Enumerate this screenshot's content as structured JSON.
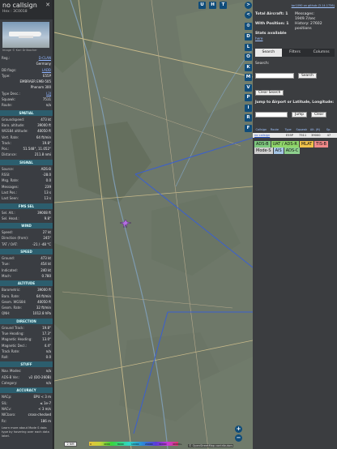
{
  "info": {
    "callsign": "no callsign",
    "hex": "Hex : 3C0018",
    "photo_credit": "Image © Karl Drilbacher",
    "details": [
      {
        "k": "Reg.:",
        "v": "D-CLAN",
        "link": true
      },
      {
        "k": "",
        "v": "Germany",
        "link": false
      },
      {
        "k": "DB flags:",
        "v": "LADD",
        "link": true
      },
      {
        "k": "Type:",
        "v": "E55P",
        "link": false
      },
      {
        "k": "",
        "v": "EMBRAER EMB-505",
        "link": false
      },
      {
        "k": "",
        "v": "Phenom 300",
        "link": false
      },
      {
        "k": "Type Desc.:",
        "v": "L2J",
        "link": true
      },
      {
        "k": "Squawk:",
        "v": "7511",
        "link": false
      },
      {
        "k": "Route:",
        "v": "n/a",
        "link": false
      }
    ],
    "sections": [
      {
        "title": "SPATIAL",
        "rows": [
          {
            "k": "Groundspeed:",
            "v": "473 kt"
          },
          {
            "k": "Baro. altitude:",
            "v": "39000 ft"
          },
          {
            "k": "WGS84 altitude:",
            "v": "40050 ft"
          },
          {
            "k": "Vert. Rate:",
            "v": "64 ft/min"
          },
          {
            "k": "Track:",
            "v": "19.8°"
          },
          {
            "k": "Pos.:",
            "v": "51.548°, 11.052°"
          },
          {
            "k": "Distance:",
            "v": "211.8 nmi"
          }
        ]
      },
      {
        "title": "SIGNAL",
        "rows": [
          {
            "k": "Source:",
            "v": "ADS-B"
          },
          {
            "k": "RSSI:",
            "v": "-28.0"
          },
          {
            "k": "Msg. Rate:",
            "v": "0.0"
          },
          {
            "k": "Messages:",
            "v": "239"
          },
          {
            "k": "Last Pos.:",
            "v": "13 s"
          },
          {
            "k": "Last Seen:",
            "v": "13 s"
          }
        ]
      },
      {
        "title": "FMS SEL",
        "rows": [
          {
            "k": "Sel. Alt.:",
            "v": "39008 ft"
          },
          {
            "k": "Sel. Head.:",
            "v": "9.8°"
          }
        ]
      },
      {
        "title": "WIND",
        "rows": [
          {
            "k": "Speed:",
            "v": "27 kt"
          },
          {
            "k": "Direction (from):",
            "v": "245°"
          },
          {
            "k": "TAT / OAT:",
            "v": "-21 / -48 °C"
          }
        ]
      },
      {
        "title": "SPEED",
        "rows": [
          {
            "k": "Ground:",
            "v": "473 kt"
          },
          {
            "k": "True:",
            "v": "454 kt"
          },
          {
            "k": "Indicated:",
            "v": "240 kt"
          },
          {
            "k": "Mach:",
            "v": "0.780"
          }
        ]
      },
      {
        "title": "ALTITUDE",
        "rows": [
          {
            "k": "Barometric:",
            "v": "39000 ft"
          },
          {
            "k": "Baro. Rate:",
            "v": "64 ft/min"
          },
          {
            "k": "Geom. WGS84:",
            "v": "40050 ft"
          },
          {
            "k": "Geom. Rate:",
            "v": "32 ft/min"
          },
          {
            "k": "QNH:",
            "v": "1012.8 hPa"
          }
        ]
      },
      {
        "title": "DIRECTION",
        "rows": [
          {
            "k": "Ground Track:",
            "v": "19.8°"
          },
          {
            "k": "True Heading:",
            "v": "17.3°"
          },
          {
            "k": "Magnetic Heading:",
            "v": "13.0°"
          },
          {
            "k": "Magnetic Decl.:",
            "v": "4.4°"
          },
          {
            "k": "Track Rate:",
            "v": "n/a"
          },
          {
            "k": "Roll:",
            "v": "0.0"
          }
        ]
      },
      {
        "title": "STUFF",
        "rows": [
          {
            "k": "Nav. Modes:",
            "v": "n/a"
          },
          {
            "k": "ADS-B Ver.:",
            "v": "v2 (DO-260B)"
          },
          {
            "k": "Category:",
            "v": "n/a"
          }
        ]
      },
      {
        "title": "ACCURACY",
        "rows": [
          {
            "k": "NACp:",
            "v": "EPU < 3 m"
          },
          {
            "k": "SIL:",
            "v": "≤ 1e-7"
          },
          {
            "k": "NACv:",
            "v": "< 3 m/s"
          },
          {
            "k": "NICbaro:",
            "v": "cross-checked"
          },
          {
            "k": "Rc:",
            "v": "186 m"
          }
        ]
      }
    ],
    "note": "Learn more about Mode S data type by hovering over each data label."
  },
  "map": {
    "layer_buttons": [
      "U",
      "H",
      "T"
    ],
    "side_buttons": [
      "D",
      "L",
      "O",
      "K",
      "M",
      "V",
      "P",
      "I",
      "R",
      "F"
    ],
    "arrows": [
      ">",
      "<"
    ],
    "zoom_in": "+",
    "zoom_out": "−",
    "scale_label": "2 NM",
    "colorbar_labels": [
      "0",
      "4000",
      "8000",
      "10000",
      "20000",
      "30000",
      "40000+"
    ],
    "attribution": "© OpenStreetMap contributors"
  },
  "side": {
    "top_link": "tar1090 on github (3.14.1736)",
    "stats": [
      {
        "label": "Total Aircraft:",
        "value": "1"
      },
      {
        "label": "Messages:",
        "value": "1949.7/sec"
      },
      {
        "label": "With Position:",
        "value": "1"
      },
      {
        "label": "History:",
        "value": "27602 positions"
      }
    ],
    "stats_available": "Stats available",
    "here": "here",
    "tabs": [
      "Search",
      "Filters",
      "Columns"
    ],
    "search_label": "Search:",
    "search_button": "Search",
    "clear_button": "Clear Search",
    "jump_label": "Jump to Airport or Latitude, Longitude:",
    "jump_button": "Jump",
    "clear_small": "Clear",
    "table_headers": [
      "Callsign",
      "Route",
      "Type",
      "Squawk",
      "Alt. (ft)",
      "Sp."
    ],
    "table_row": {
      "callsign": "no callsign",
      "route": "",
      "type": "E55P",
      "squawk": "7511",
      "alt": "39000",
      "speed": "47"
    },
    "legend": [
      {
        "label": "ADS-B",
        "color": "#7ec87e"
      },
      {
        "label": "UAT / ADS-R",
        "color": "#8fd66a"
      },
      {
        "label": "MLAT",
        "color": "#f0c24a"
      },
      {
        "label": "TIS-B",
        "color": "#f08a8a"
      },
      {
        "label": "Mode-S",
        "color": "#cfcfcf"
      },
      {
        "label": "AIS",
        "color": "#a6c6e6"
      },
      {
        "label": "ADS-C",
        "color": "#8ed08e"
      }
    ]
  }
}
